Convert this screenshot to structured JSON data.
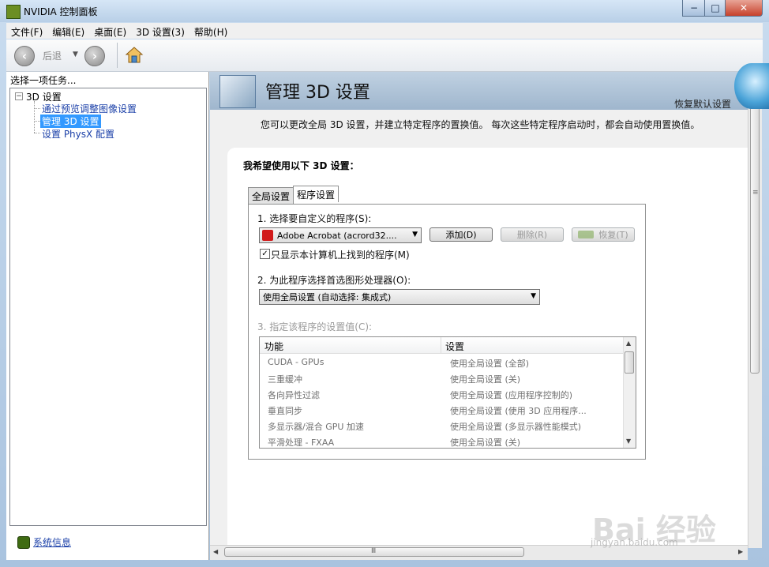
{
  "window": {
    "title": "NVIDIA 控制面板",
    "btn_min": "−",
    "btn_max": "□",
    "btn_close": "✕"
  },
  "menu": [
    "文件(F)",
    "编辑(E)",
    "桌面(E)",
    "3D 设置(3)",
    "帮助(H)"
  ],
  "toolbar": {
    "back_label": "后退",
    "back_icon": "back-arrow-icon",
    "forward_icon": "forward-arrow-icon",
    "home_icon": "home-icon"
  },
  "left": {
    "header": "选择一项任务...",
    "tree_root": "3D 设置",
    "tree_children": [
      "通过预览调整图像设置",
      "管理 3D 设置",
      "设置 PhysX 配置"
    ],
    "selected_index": 1,
    "system_info": "系统信息"
  },
  "banner": {
    "title": "管理 3D 设置",
    "restore_defaults": "恢复默认设置"
  },
  "description": "您可以更改全局 3D 设置，并建立特定程序的置换值。 每次这些特定程序启动时，都会自动使用置换值。",
  "settings": {
    "heading": "我希望使用以下 3D 设置：",
    "tabs": [
      "全局设置",
      "程序设置"
    ],
    "active_tab": 1,
    "step1_label": "1. 选择要自定义的程序(S):",
    "program_selected": "Adobe Acrobat (acrord32....",
    "add_button": "添加(D)",
    "remove_button": "删除(R)",
    "restore_button": "恢复(T)",
    "show_only_checkbox": "只显示本计算机上找到的程序(M)",
    "show_only_checked": true,
    "step2_label": "2. 为此程序选择首选图形处理器(O):",
    "gpu_selected": "使用全局设置 (自动选择: 集成式)",
    "step3_label": "3. 指定该程序的设置值(C):",
    "grid_headers": [
      "功能",
      "设置"
    ],
    "grid_rows": [
      [
        "CUDA - GPUs",
        "使用全局设置 (全部)"
      ],
      [
        "三重缓冲",
        "使用全局设置 (关)"
      ],
      [
        "各向异性过滤",
        "使用全局设置 (应用程序控制的)"
      ],
      [
        "垂直同步",
        "使用全局设置 (使用 3D 应用程序..."
      ],
      [
        "多显示器/混合 GPU 加速",
        "使用全局设置 (多显示器性能模式)"
      ],
      [
        "平滑处理 - FXAA",
        "使用全局设置 (关)"
      ]
    ]
  },
  "watermark": {
    "text": "Bai 经验",
    "sub": "jingyan.baidu.com"
  }
}
